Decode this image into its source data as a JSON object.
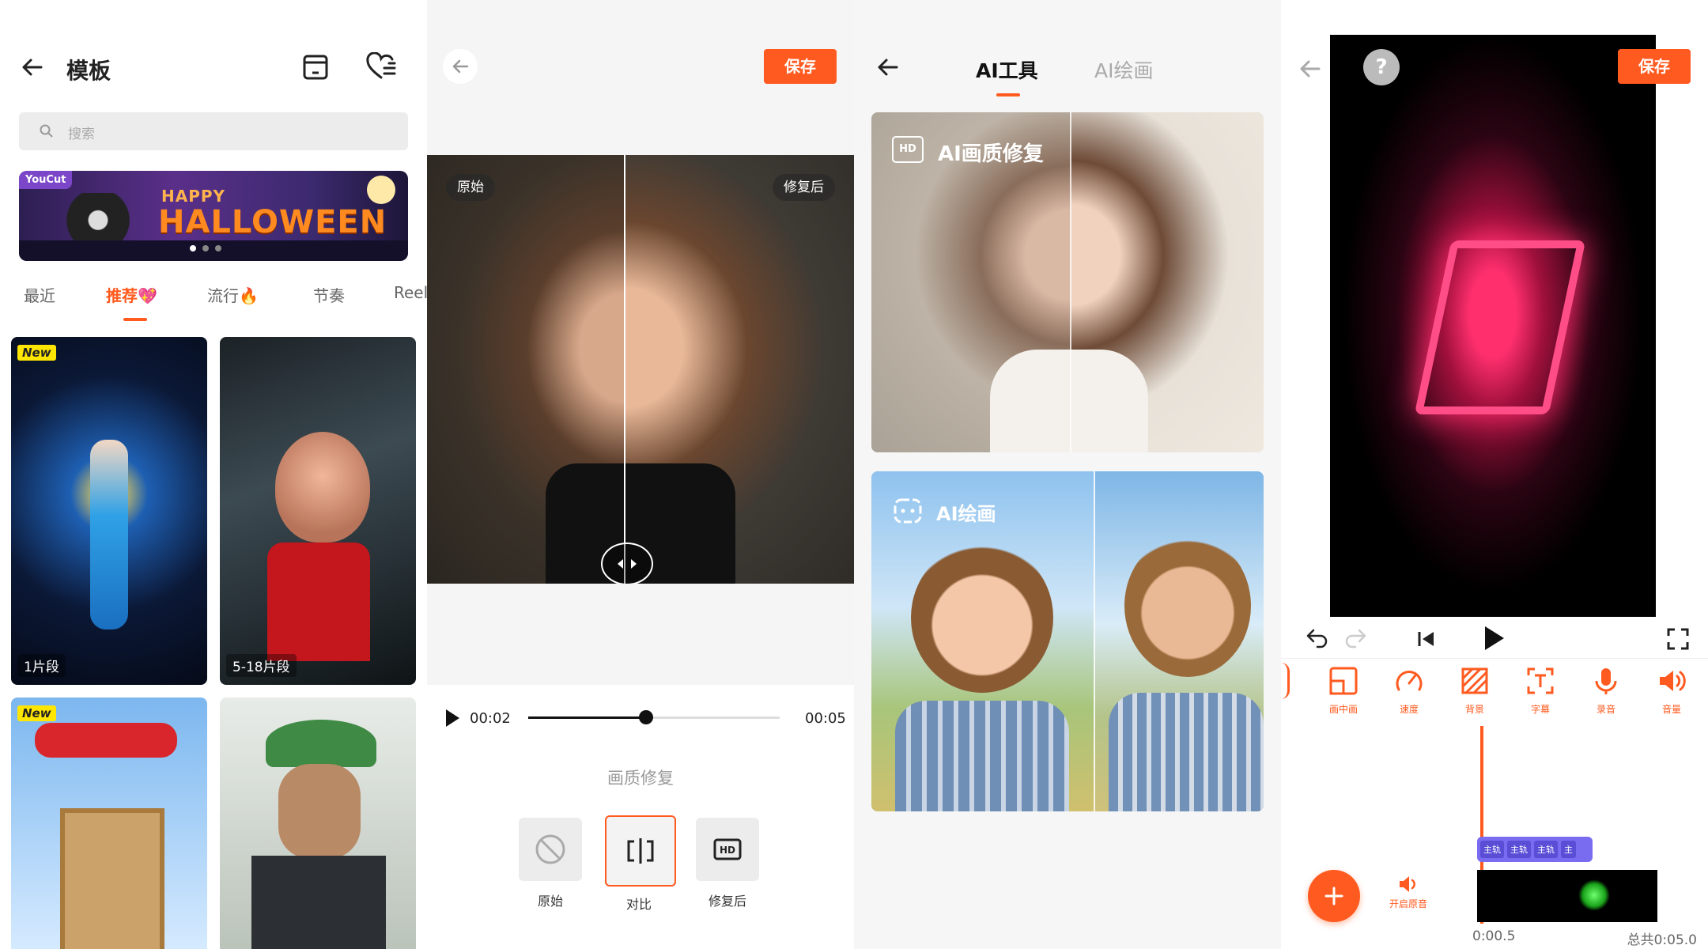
{
  "colors": {
    "accent": "#ff5a1f",
    "background": "#f6f6f6"
  },
  "s1": {
    "title": "模板",
    "search_placeholder": "搜索",
    "banner": {
      "brand": "YouCut",
      "line1": "HAPPY",
      "line2": "HALLOWEEN"
    },
    "tabs": [
      {
        "label": "最近",
        "emoji": ""
      },
      {
        "label": "推荐",
        "emoji": "💖"
      },
      {
        "label": "流行",
        "emoji": "🔥"
      },
      {
        "label": "节奏",
        "emoji": ""
      },
      {
        "label": "Reel",
        "emoji": ""
      }
    ],
    "cards": [
      {
        "badge": "New",
        "clips": "1片段"
      },
      {
        "badge": "",
        "clips": "5-18片段"
      },
      {
        "badge": "New",
        "clips": ""
      },
      {
        "badge": "",
        "clips": ""
      }
    ]
  },
  "s2": {
    "save": "保存",
    "original_chip": "原始",
    "restored_chip": "修复后",
    "current_time": "00:02",
    "total_time": "00:05",
    "progress": 0.47,
    "section_title": "画质修复",
    "modes": [
      {
        "label": "原始",
        "icon": "ban-icon"
      },
      {
        "label": "对比",
        "icon": "compare-icon"
      },
      {
        "label": "修复后",
        "icon": "hd-icon"
      }
    ],
    "selected_mode": "对比"
  },
  "s3": {
    "tabs": [
      "AI工具",
      "AI绘画"
    ],
    "active_tab": "AI工具",
    "card1_title": "AI画质修复",
    "card1_icon": "HD",
    "card2_title": "AI绘画"
  },
  "s4": {
    "help": "?",
    "save": "保存",
    "tools": [
      {
        "label": "画中画",
        "icon": "pip-icon"
      },
      {
        "label": "速度",
        "icon": "speed-icon"
      },
      {
        "label": "背景",
        "icon": "background-icon"
      },
      {
        "label": "字幕",
        "icon": "text-icon"
      },
      {
        "label": "录音",
        "icon": "mic-icon"
      },
      {
        "label": "音量",
        "icon": "volume-icon"
      }
    ],
    "tracks": [
      "主轨",
      "主轨",
      "主轨",
      "主"
    ],
    "mute_label": "开启原音",
    "current_time": "0:00.5",
    "total_time": "总共0:05.0"
  }
}
